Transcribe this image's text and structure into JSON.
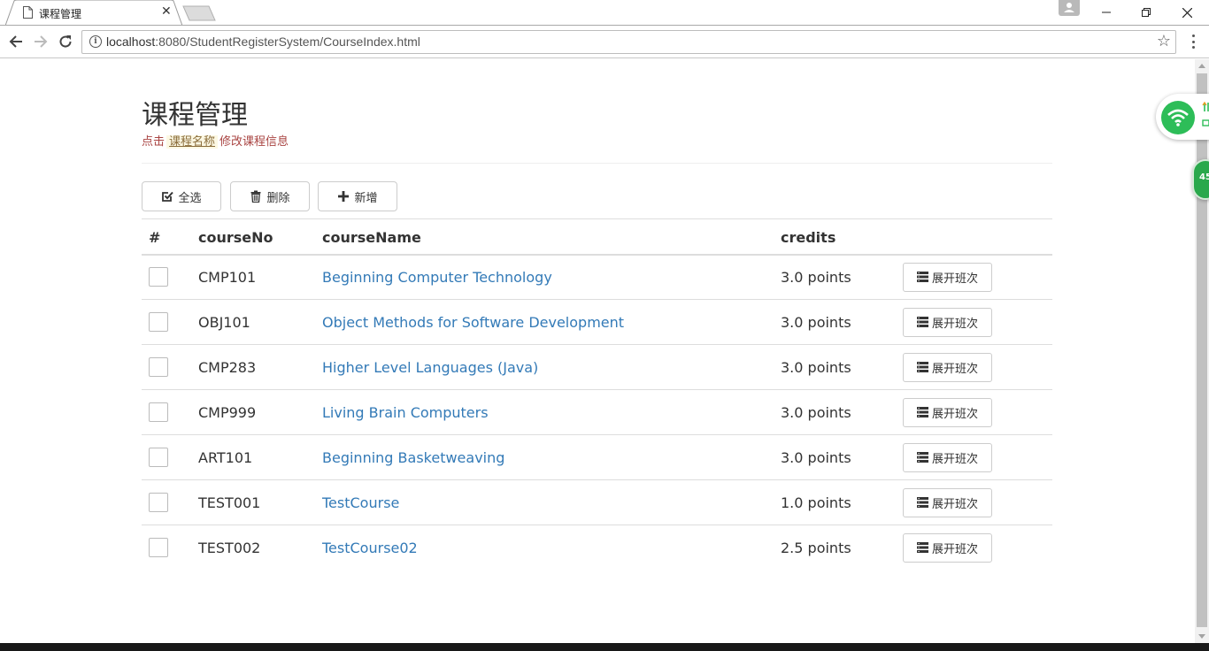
{
  "browser": {
    "tab_title": "课程管理",
    "tab_close": "✕",
    "url_host": "localhost",
    "url_rest": ":8080/StudentRegisterSystem/CourseIndex.html"
  },
  "page": {
    "title": "课程管理",
    "hint_prefix": "点击",
    "hint_highlight": "课程名称",
    "hint_suffix": "修改课程信息"
  },
  "toolbar": {
    "select_all_label": "全选",
    "delete_label": "删除",
    "add_label": "新增"
  },
  "table": {
    "headers": [
      "#",
      "courseNo",
      "courseName",
      "credits"
    ],
    "expand_label": "展开班次",
    "rows": [
      {
        "no": "CMP101",
        "name": "Beginning Computer Technology",
        "credits": "3.0 points"
      },
      {
        "no": "OBJ101",
        "name": "Object Methods for Software Development",
        "credits": "3.0 points"
      },
      {
        "no": "CMP283",
        "name": "Higher Level Languages (Java)",
        "credits": "3.0 points"
      },
      {
        "no": "CMP999",
        "name": "Living Brain Computers",
        "credits": "3.0 points"
      },
      {
        "no": "ART101",
        "name": "Beginning Basketweaving",
        "credits": "3.0 points"
      },
      {
        "no": "TEST001",
        "name": "TestCourse",
        "credits": "1.0 points"
      },
      {
        "no": "TEST002",
        "name": "TestCourse02",
        "credits": "2.5 points"
      }
    ]
  },
  "widgets": {
    "speed": "45"
  },
  "colors": {
    "link": "#337ab7",
    "hint": "#a94442",
    "highlight_bg": "#fcf8e3",
    "wifi_green": "#2dbd58"
  }
}
